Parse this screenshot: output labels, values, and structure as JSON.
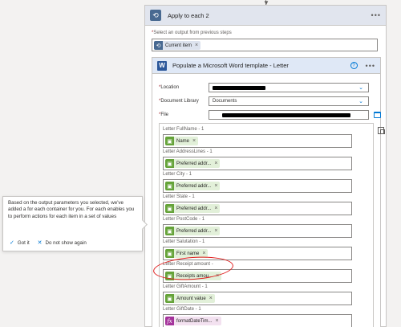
{
  "apply_each": {
    "title": "Apply to each 2",
    "menu_icon": "•••",
    "select_label_required": "*",
    "select_label": "Select an output from previous steps",
    "token": {
      "label": "Current item",
      "icon": "loop-icon",
      "remove": "×"
    }
  },
  "word_action": {
    "title": "Populate a Microsoft Word template - Letter",
    "help_icon": "?",
    "menu_icon": "•••",
    "fields": [
      {
        "required": "*",
        "label": "Location",
        "value": ""
      },
      {
        "required": "*",
        "label": "Document Library",
        "value": "Documents"
      },
      {
        "required": "*",
        "label": "File",
        "value": ""
      }
    ],
    "parameters": [
      {
        "label": "Letter FullName - 1",
        "token": "Name",
        "kind": "green"
      },
      {
        "label": "Letter AddressLines - 1",
        "token": "Preferred addr...",
        "kind": "green"
      },
      {
        "label": "Letter City - 1",
        "token": "Preferred addr...",
        "kind": "green"
      },
      {
        "label": "Letter State - 1",
        "token": "Preferred addr...",
        "kind": "green"
      },
      {
        "label": "Letter PostCode - 1",
        "token": "Preferred addr...",
        "kind": "green"
      },
      {
        "label": "Letter Salutation - 1",
        "token": "First name",
        "kind": "green"
      },
      {
        "label": "Letter Receipt amount -",
        "token": "Receipts amou...",
        "kind": "green"
      },
      {
        "label": "Letter GiftAmount - 1",
        "token": "Amount value",
        "kind": "green"
      },
      {
        "label": "Letter GiftDate - 1",
        "token": "formatDateTim...",
        "kind": "pink"
      }
    ],
    "token_remove": "×"
  },
  "callout": {
    "text": "Based on the output parameters you selected, we've added a for each container for you. For each enables you to perform actions for each item in a set of values",
    "got_it": "Got it",
    "do_not_show": "Do not show again"
  },
  "colors": {
    "accent": "#0078d4",
    "apply_header": "#e1e5ee",
    "word_header": "#dfe8f6",
    "token_green": "#65a339",
    "token_pink": "#a4339b",
    "annotation_red": "#e02020"
  }
}
